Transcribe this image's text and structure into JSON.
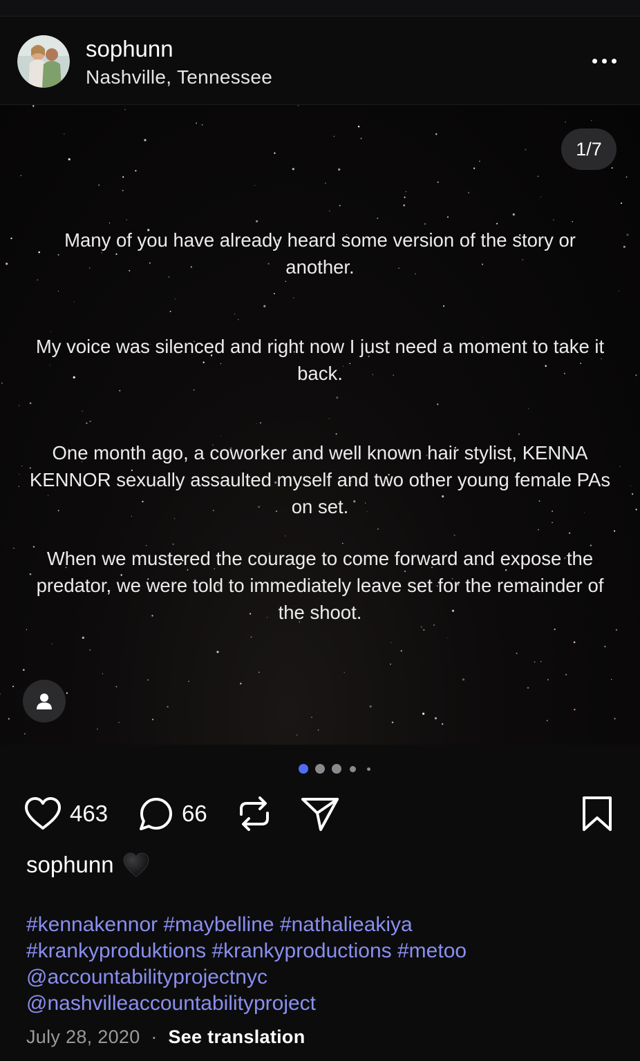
{
  "post": {
    "username": "sophunn",
    "location": "Nashville, Tennessee",
    "slide_counter": "1/7",
    "slide_paragraphs": [
      "Many of you have already heard some version of the story or another.",
      "My voice was silenced and right now I just need a moment to take it back.",
      "One month ago, a coworker and well known hair stylist, KENNA KENNOR sexually assaulted myself and two other young female PAs on set.",
      "When we mustered the courage to come forward and expose the predator, we were told to immediately leave set for the remainder of the shoot."
    ],
    "carousel_dots": {
      "total_visible": 5,
      "active_index": 0,
      "active_color": "#4f6ef7",
      "inactive_color": "#8a8a8e"
    }
  },
  "actions": {
    "likes": "463",
    "comments": "66"
  },
  "caption": {
    "username": "sophunn",
    "emoji": "black-heart",
    "tag_line_1": [
      "#kennakennor",
      "#maybelline",
      "#nathalieakiya"
    ],
    "tag_line_2": [
      "#krankyproduktions",
      "#krankyproductions",
      "#metoo"
    ],
    "mention_1": "@accountabilityprojectnyc",
    "mention_2": "@nashvilleaccountabilityproject",
    "date": "July 28, 2020",
    "separator": "·",
    "see_translation": "See translation"
  },
  "colors": {
    "background": "#0c0c0d",
    "link": "#8a8ff0",
    "accent": "#4f6ef7"
  }
}
